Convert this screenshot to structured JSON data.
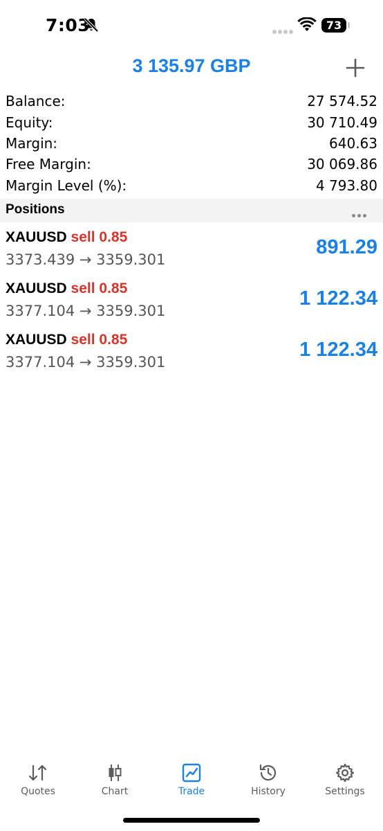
{
  "status": {
    "time": "7:03",
    "battery": "73"
  },
  "header": {
    "title": "3 135.97 GBP"
  },
  "account": [
    {
      "label": "Balance:",
      "value": "27 574.52"
    },
    {
      "label": "Equity:",
      "value": "30 710.49"
    },
    {
      "label": "Margin:",
      "value": "640.63"
    },
    {
      "label": "Free Margin:",
      "value": "30 069.86"
    },
    {
      "label": "Margin Level (%):",
      "value": "4 793.80"
    }
  ],
  "positions_header": {
    "label": "Positions"
  },
  "positions": [
    {
      "symbol": "XAUUSD",
      "direction": "sell 0.85",
      "prices": "3373.439 → 3359.301",
      "profit": "891.29"
    },
    {
      "symbol": "XAUUSD",
      "direction": "sell 0.85",
      "prices": "3377.104 → 3359.301",
      "profit": "1 122.34"
    },
    {
      "symbol": "XAUUSD",
      "direction": "sell 0.85",
      "prices": "3377.104 → 3359.301",
      "profit": "1 122.34"
    }
  ],
  "tabs": [
    {
      "label": "Quotes",
      "icon": "quotes-icon"
    },
    {
      "label": "Chart",
      "icon": "chart-icon"
    },
    {
      "label": "Trade",
      "icon": "trade-icon",
      "active": true
    },
    {
      "label": "History",
      "icon": "history-icon"
    },
    {
      "label": "Settings",
      "icon": "settings-icon"
    }
  ],
  "colors": {
    "accent": "#1a80e5",
    "sell": "#d8342a",
    "section_bg": "#f3f3f3"
  }
}
